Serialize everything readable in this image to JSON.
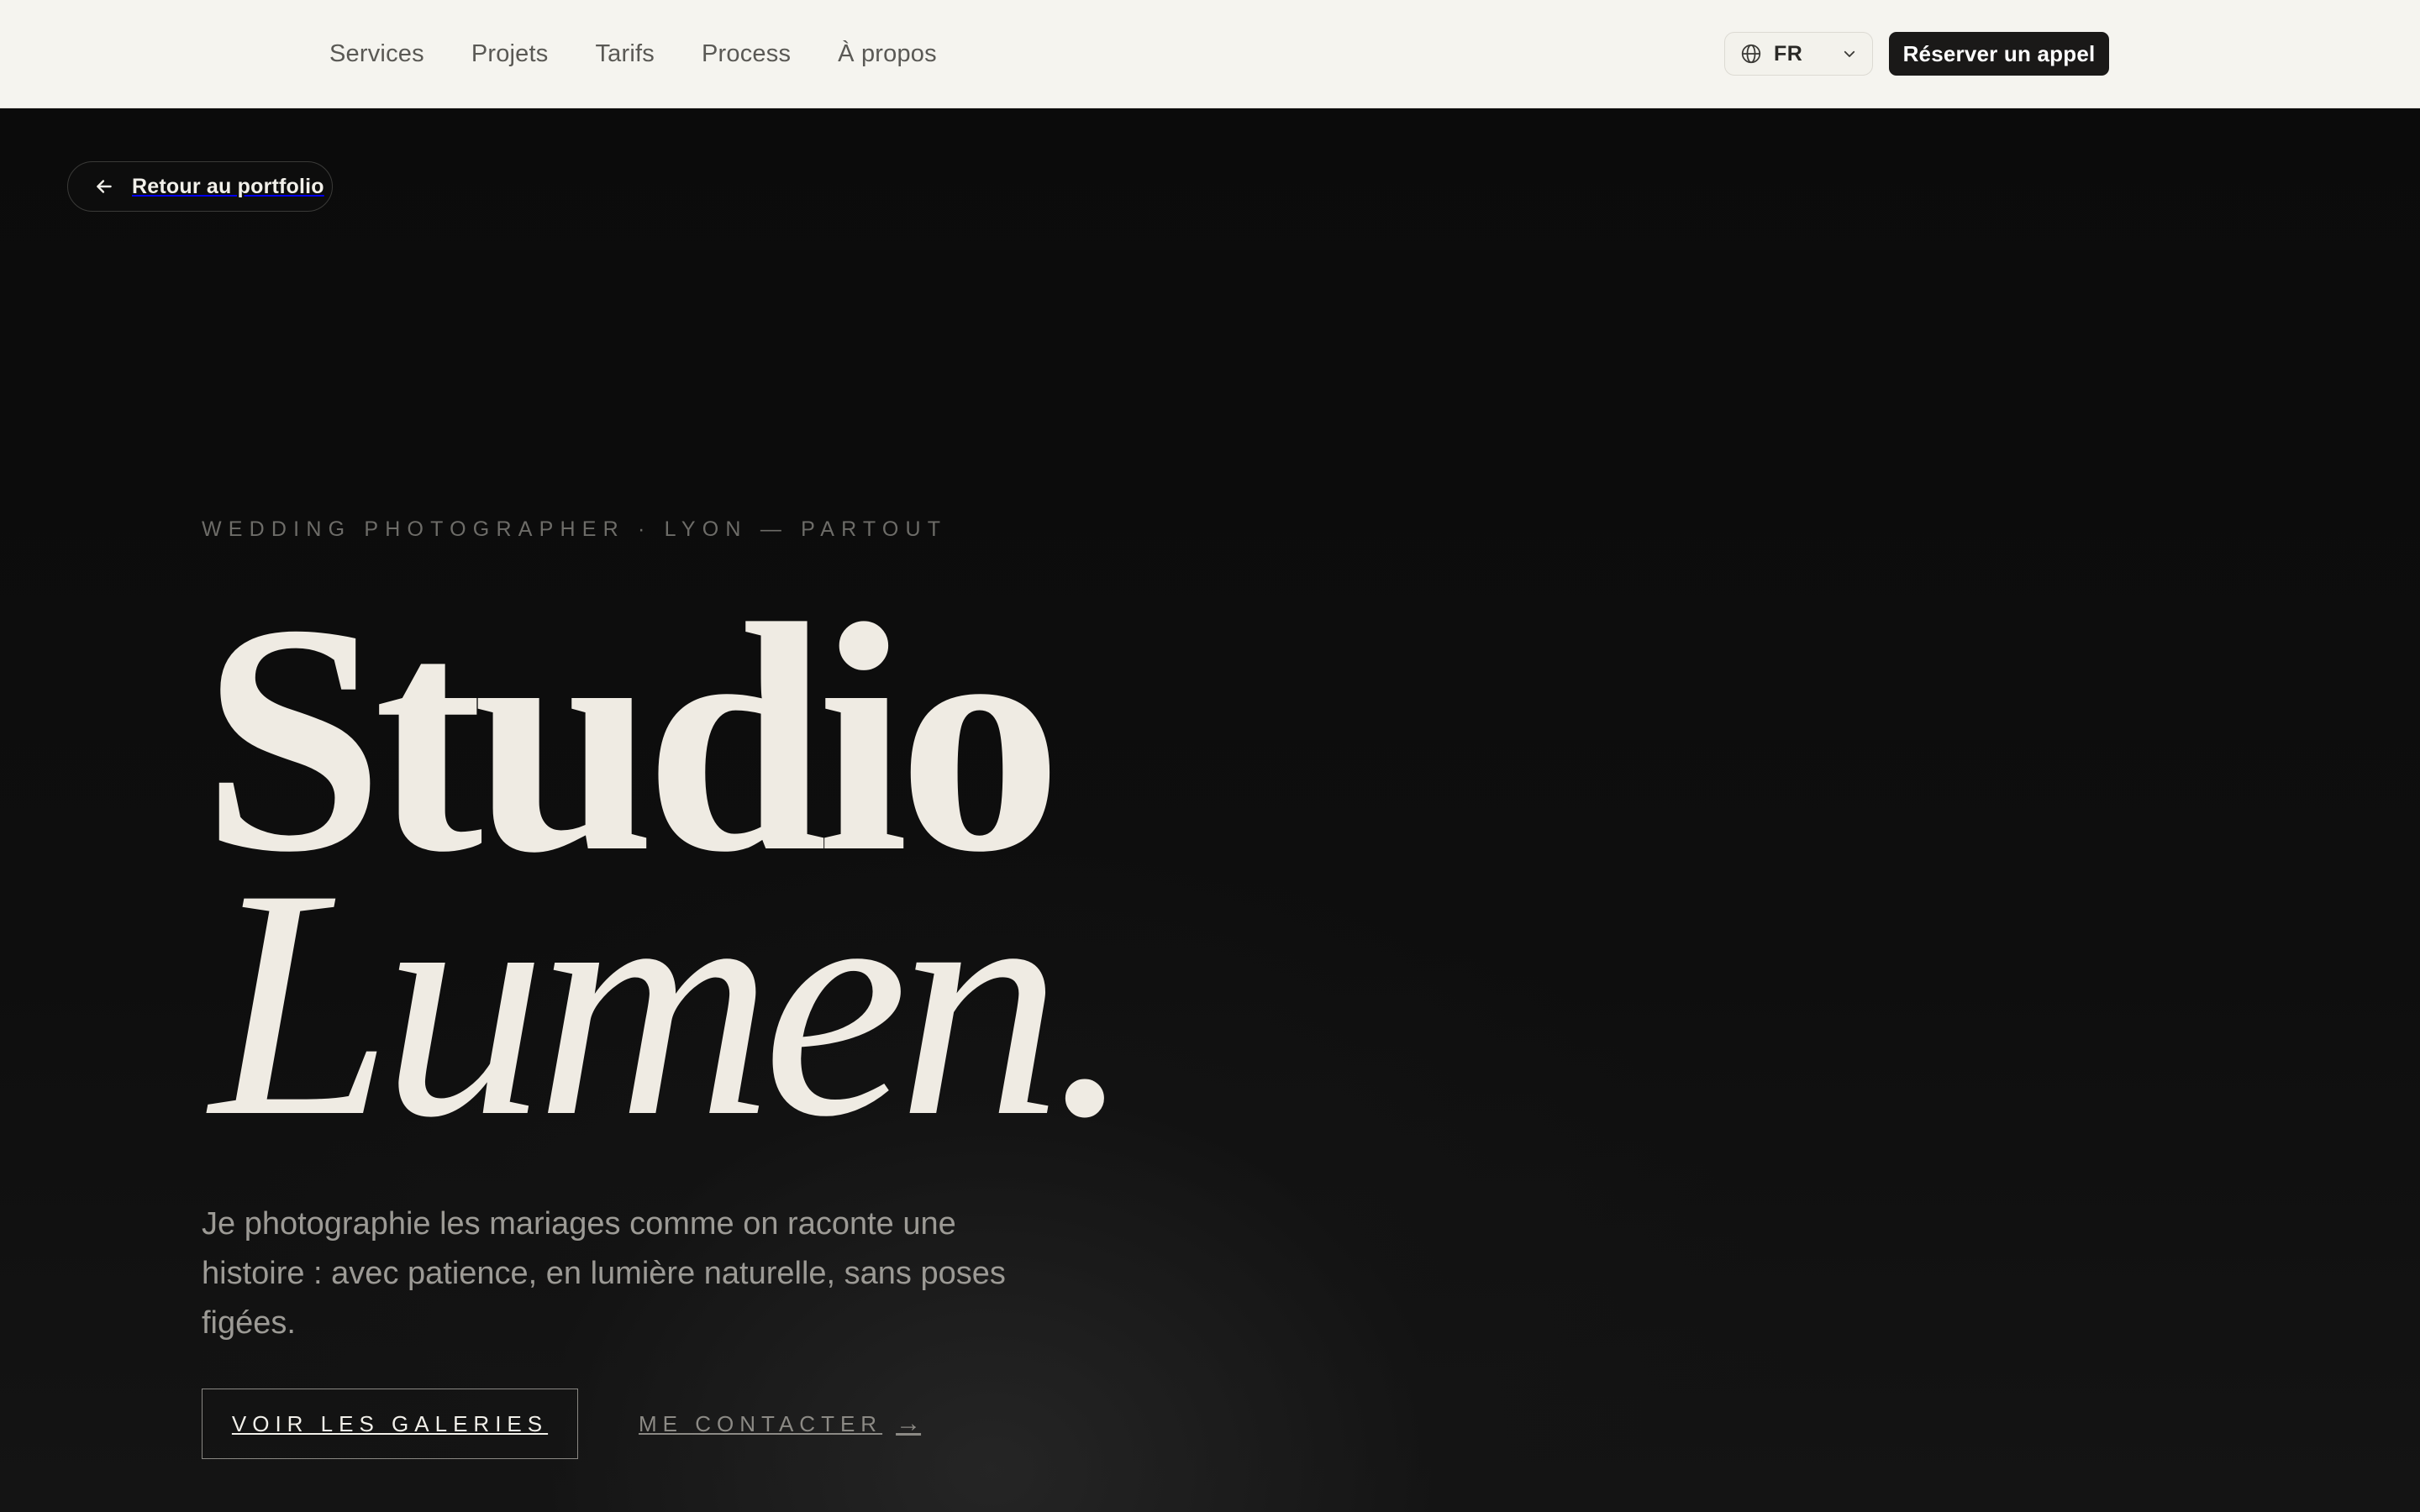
{
  "nav": {
    "items": [
      {
        "label": "Services"
      },
      {
        "label": "Projets"
      },
      {
        "label": "Tarifs"
      },
      {
        "label": "Process"
      },
      {
        "label": "À propos"
      }
    ],
    "language": {
      "code": "FR",
      "icon": "globe-icon"
    },
    "cta_label": "Réserver un appel"
  },
  "hero": {
    "back_label": "Retour au portfolio",
    "eyebrow": "WEDDING PHOTOGRAPHER · LYON — PARTOUT",
    "title_line1": "Studio",
    "title_line2": "Lumen.",
    "lead": "Je photographie les mariages comme on raconte une histoire : avec patience, en lumière naturelle, sans poses figées.",
    "primary_cta": "VOIR LES GALERIES",
    "secondary_cta": "ME CONTACTER",
    "secondary_arrow": "→"
  },
  "colors": {
    "topbar_bg": "#f5f4ef",
    "hero_bg": "#0b0b0b",
    "title_text": "#efebe3",
    "cta_bg": "#1a1918"
  }
}
